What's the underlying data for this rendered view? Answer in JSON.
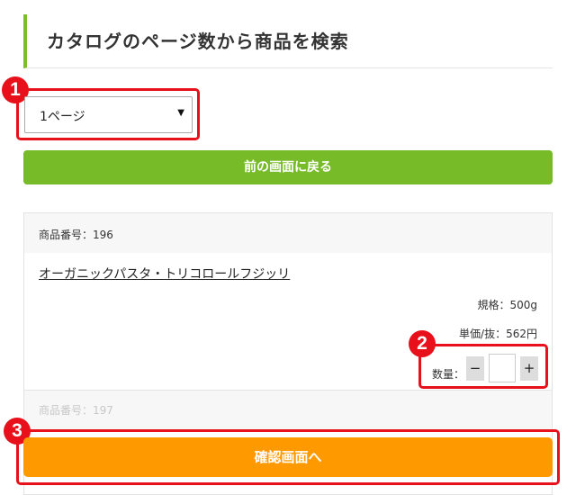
{
  "header": {
    "title": "カタログのページ数から商品を検索"
  },
  "annotations": {
    "badge1": "1",
    "badge2": "2",
    "badge3": "3"
  },
  "page_select": {
    "selected": "1ページ"
  },
  "back_button": {
    "label": "前の画面に戻る"
  },
  "product": {
    "number": "商品番号：196",
    "name": "オーガニックパスタ・トリコロールフジッリ",
    "spec": "規格：500g",
    "unit_price": "単価/抜：562円",
    "qty_label": "数量：",
    "minus": "−",
    "plus": "+"
  },
  "next_product": {
    "number": "商品番号：197"
  },
  "confirm_button": {
    "label": "確認画面へ"
  },
  "colors": {
    "accent_green": "#77bb29",
    "confirm_orange": "#fe9900",
    "annotation_red": "#e8101a"
  }
}
